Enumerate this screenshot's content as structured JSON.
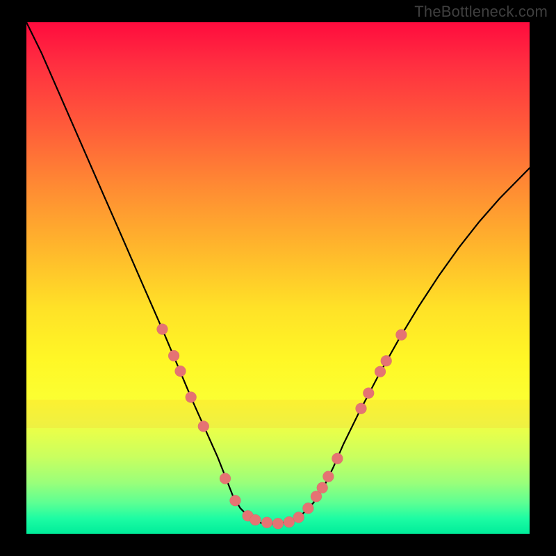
{
  "watermark": "TheBottleneck.com",
  "colors": {
    "frame_bg": "#000000",
    "curve": "#000000",
    "marker": "#e57373",
    "gradient_stops": [
      "#ff0b3e",
      "#ff2e40",
      "#ff5a3a",
      "#ff8a33",
      "#ffb62c",
      "#ffe227",
      "#fff726",
      "#fbff32",
      "#e8ff4a",
      "#c9ff5f",
      "#9aff7a",
      "#5cff93",
      "#1dfca3",
      "#00ed9a"
    ]
  },
  "chart_data": {
    "type": "line",
    "title": "",
    "xlabel": "",
    "ylabel": "",
    "xlim": [
      0,
      1
    ],
    "ylim": [
      0,
      1
    ],
    "note": "Axes are unlabeled in the image; coordinates are normalized (0–1) within the colored plot area, y=0 at bottom.",
    "series": [
      {
        "name": "curve",
        "x": [
          0.0,
          0.03,
          0.07,
          0.11,
          0.15,
          0.19,
          0.23,
          0.27,
          0.3,
          0.33,
          0.355,
          0.38,
          0.4,
          0.41,
          0.425,
          0.44,
          0.455,
          0.47,
          0.5,
          0.53,
          0.55,
          0.57,
          0.59,
          0.61,
          0.63,
          0.66,
          0.7,
          0.74,
          0.78,
          0.82,
          0.86,
          0.9,
          0.94,
          0.98,
          1.0
        ],
        "y": [
          1.0,
          0.94,
          0.85,
          0.76,
          0.67,
          0.58,
          0.49,
          0.4,
          0.33,
          0.26,
          0.205,
          0.15,
          0.1,
          0.075,
          0.05,
          0.035,
          0.025,
          0.02,
          0.02,
          0.025,
          0.04,
          0.06,
          0.09,
          0.13,
          0.175,
          0.235,
          0.31,
          0.38,
          0.445,
          0.505,
          0.56,
          0.61,
          0.655,
          0.695,
          0.715
        ]
      }
    ],
    "markers": {
      "name": "highlight-points",
      "comment": "Salmon dots along the curve near the valley and shoulders.",
      "points": [
        {
          "x": 0.27,
          "y": 0.4
        },
        {
          "x": 0.293,
          "y": 0.348
        },
        {
          "x": 0.306,
          "y": 0.318
        },
        {
          "x": 0.327,
          "y": 0.267
        },
        {
          "x": 0.352,
          "y": 0.21
        },
        {
          "x": 0.395,
          "y": 0.108
        },
        {
          "x": 0.415,
          "y": 0.065
        },
        {
          "x": 0.44,
          "y": 0.035
        },
        {
          "x": 0.455,
          "y": 0.027
        },
        {
          "x": 0.478,
          "y": 0.022
        },
        {
          "x": 0.5,
          "y": 0.02
        },
        {
          "x": 0.522,
          "y": 0.023
        },
        {
          "x": 0.541,
          "y": 0.032
        },
        {
          "x": 0.56,
          "y": 0.05
        },
        {
          "x": 0.576,
          "y": 0.073
        },
        {
          "x": 0.588,
          "y": 0.09
        },
        {
          "x": 0.6,
          "y": 0.112
        },
        {
          "x": 0.618,
          "y": 0.147
        },
        {
          "x": 0.665,
          "y": 0.245
        },
        {
          "x": 0.68,
          "y": 0.275
        },
        {
          "x": 0.703,
          "y": 0.317
        },
        {
          "x": 0.715,
          "y": 0.338
        },
        {
          "x": 0.745,
          "y": 0.389
        }
      ],
      "radius_px": 8
    },
    "band": {
      "comment": "Faint horizontal band overlay (orange tint).",
      "y_top": 0.262,
      "y_bottom": 0.207
    }
  }
}
